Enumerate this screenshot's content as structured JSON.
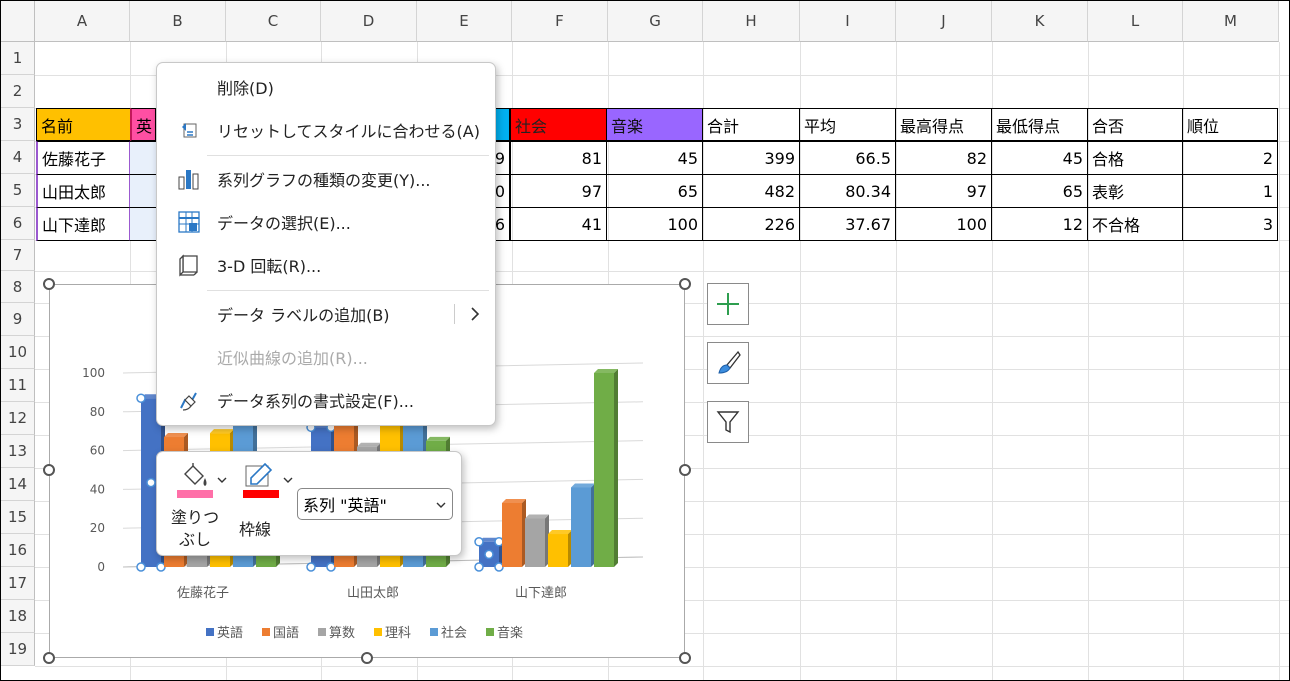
{
  "columns": [
    "A",
    "B",
    "C",
    "D",
    "E",
    "F",
    "G",
    "H",
    "I",
    "J",
    "K",
    "L",
    "M"
  ],
  "rows": [
    "1",
    "2",
    "3",
    "4",
    "5",
    "6",
    "7",
    "8",
    "9",
    "10",
    "11",
    "12",
    "13",
    "14",
    "15",
    "16",
    "17",
    "18",
    "19"
  ],
  "table": {
    "header_a": "名前",
    "header_b": "英",
    "header_f": "社会",
    "header_g": "音楽",
    "header_h": "合計",
    "header_i": "平均",
    "header_j": "最高得点",
    "header_k": "最低得点",
    "header_l": "合否",
    "header_m": "順位",
    "rows": [
      {
        "name": "佐藤花子",
        "e": "9",
        "f": "81",
        "g": "45",
        "h": "399",
        "i": "66.5",
        "j": "82",
        "k": "45",
        "l": "合格",
        "m": "2"
      },
      {
        "name": "山田太郎",
        "e": "0",
        "f": "97",
        "g": "65",
        "h": "482",
        "i": "80.34",
        "j": "97",
        "k": "65",
        "l": "表彰",
        "m": "1"
      },
      {
        "name": "山下達郎",
        "e": "6",
        "f": "41",
        "g": "100",
        "h": "226",
        "i": "37.67",
        "j": "100",
        "k": "12",
        "l": "不合格",
        "m": "3"
      }
    ]
  },
  "context_menu": {
    "delete": "削除(D)",
    "reset_style": "リセットしてスタイルに合わせる(A)",
    "change_type": "系列グラフの種類の変更(Y)...",
    "select_data": "データの選択(E)...",
    "rotate_3d": "3-D 回転(R)...",
    "add_labels": "データ ラベルの追加(B)",
    "add_trendline": "近似曲線の追加(R)...",
    "format_series": "データ系列の書式設定(F)..."
  },
  "mini_toolbar": {
    "fill_label_1": "塗りつ",
    "fill_label_2": "ぶし",
    "outline_label": "枠線",
    "series_select": "系列 \"英語\""
  },
  "chart_data": {
    "type": "bar",
    "categories": [
      "佐藤花子",
      "山田太郎",
      "山下達郎"
    ],
    "ylim": [
      0,
      100
    ],
    "yticks": [
      "0",
      "20",
      "40",
      "60",
      "80",
      "100"
    ],
    "series": [
      {
        "name": "英語",
        "color": "#4472c4",
        "values": [
          87,
          72,
          13
        ]
      },
      {
        "name": "国語",
        "color": "#ed7d31",
        "values": [
          67,
          85,
          33
        ]
      },
      {
        "name": "算数",
        "color": "#a5a5a5",
        "values": [
          50,
          62,
          25
        ]
      },
      {
        "name": "理科",
        "color": "#ffc000",
        "values": [
          69,
          74,
          17
        ]
      },
      {
        "name": "社会",
        "color": "#5b9bd5",
        "values": [
          81,
          97,
          41
        ]
      },
      {
        "name": "音楽",
        "color": "#70ad47",
        "values": [
          45,
          65,
          100
        ]
      }
    ]
  },
  "colors": {
    "gold": "#ffc000",
    "pink": "#ff4fa3",
    "cyan": "#00b0f0",
    "red": "#ff0000",
    "purple": "#9966ff",
    "fill_swatch": "#ff6fa8",
    "outline_swatch": "#ff0000"
  }
}
